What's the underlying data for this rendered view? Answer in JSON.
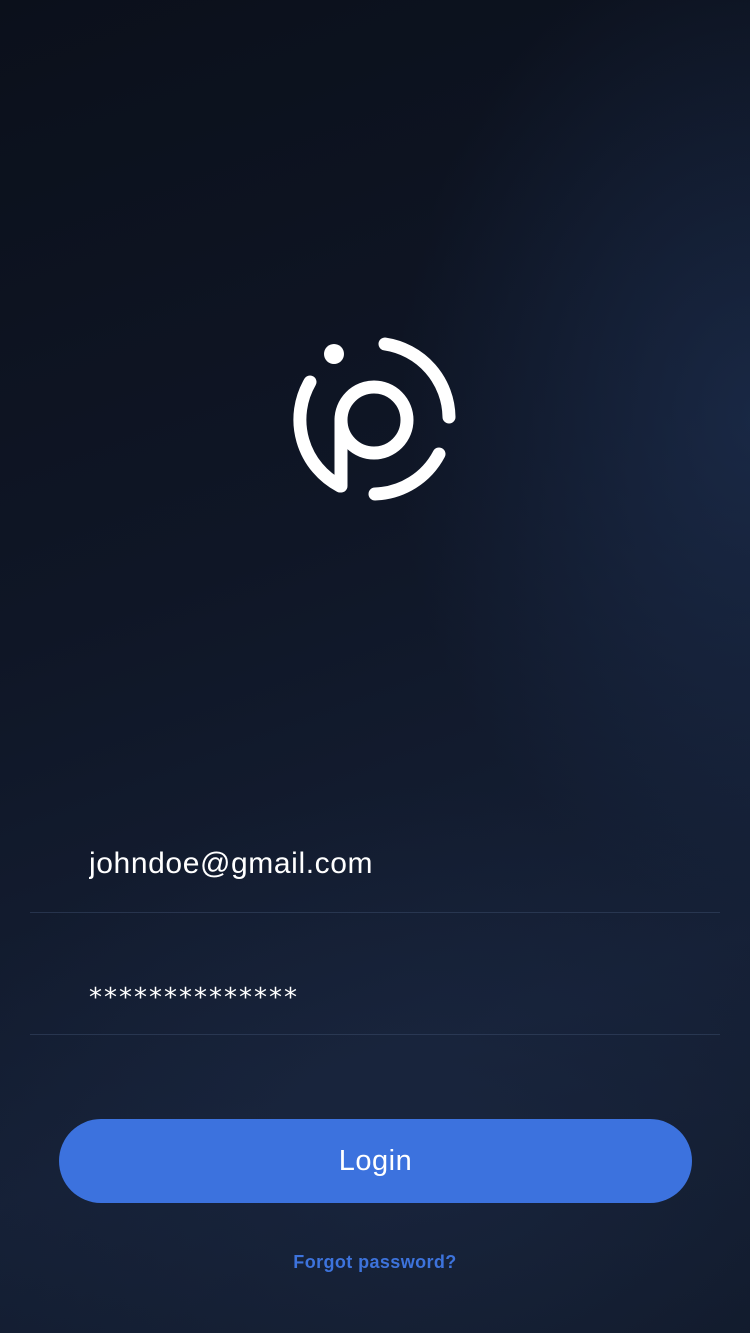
{
  "logo": {
    "icon": "app-logo-icon",
    "color": "#ffffff"
  },
  "login_form": {
    "email_value": "johndoe@gmail.com",
    "password_value": "**************",
    "login_label": "Login",
    "forgot_password_label": "Forgot password?"
  },
  "colors": {
    "accent": "#3c72de",
    "link": "#3d73dc",
    "background": "#0f1626"
  }
}
